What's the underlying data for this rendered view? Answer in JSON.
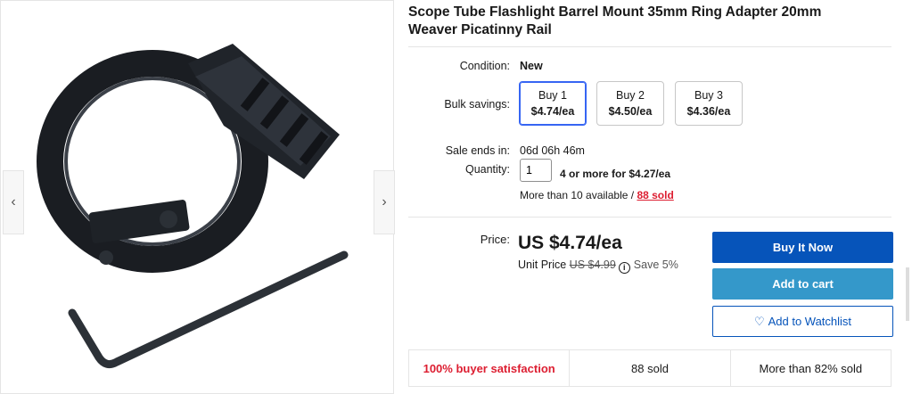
{
  "product": {
    "title": "Scope Tube Flashlight Barrel Mount 35mm Ring Adapter 20mm Weaver Picatinny Rail"
  },
  "gallery": {
    "prev_icon": "chevron-left-icon",
    "next_icon": "chevron-right-icon"
  },
  "details": {
    "condition_label": "Condition:",
    "condition_value": "New",
    "bulk_label": "Bulk savings:",
    "bulk_options": [
      {
        "qty": "Buy 1",
        "price": "$4.74/ea",
        "selected": true
      },
      {
        "qty": "Buy 2",
        "price": "$4.50/ea",
        "selected": false
      },
      {
        "qty": "Buy 3",
        "price": "$4.36/ea",
        "selected": false
      }
    ],
    "sale_label": "Sale ends in:",
    "sale_value": "06d 06h 46m",
    "quantity_label": "Quantity:",
    "quantity_value": "1",
    "quantity_offer": "4 or more for $4.27/ea",
    "availability": "More than 10 available /",
    "sold_link": "88 sold"
  },
  "price": {
    "label": "Price:",
    "value": "US $4.74/ea",
    "unit_prefix": "Unit Price",
    "original": "US $4.99",
    "save": "Save 5%"
  },
  "buttons": {
    "buy_now": "Buy It Now",
    "add_to_cart": "Add to cart",
    "watchlist": "Add to Watchlist"
  },
  "stats": {
    "satisfaction": "100% buyer satisfaction",
    "sold": "88 sold",
    "more_than": "More than 82% sold"
  },
  "colors": {
    "primary_blue": "#0654ba",
    "cart_blue": "#3498ca",
    "selected_border": "#3665f3",
    "accent_red": "#dd1e31"
  }
}
